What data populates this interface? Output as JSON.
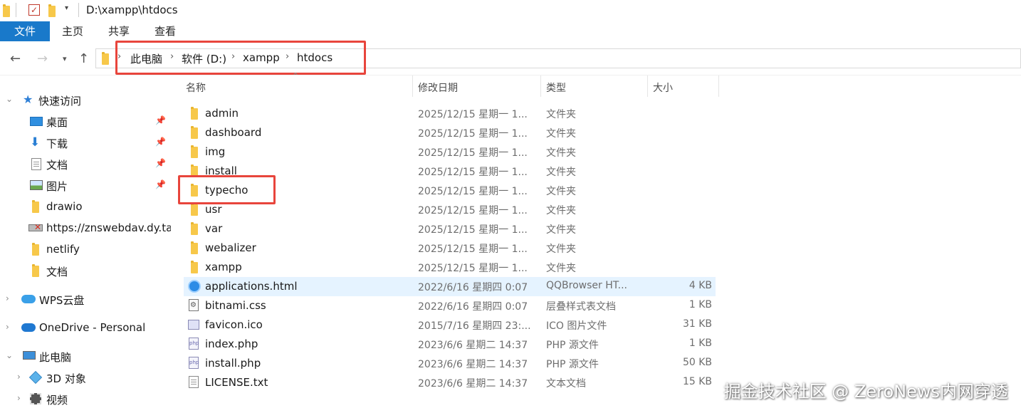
{
  "window": {
    "title": "D:\\xampp\\htdocs"
  },
  "ribbon": {
    "tabs": [
      "文件",
      "主页",
      "共享",
      "查看"
    ]
  },
  "address": {
    "crumbs": [
      "此电脑",
      "软件 (D:)",
      "xampp",
      "htdocs"
    ]
  },
  "sidebar": {
    "items": [
      {
        "label": "快速访问",
        "icon": "star-icon",
        "pinned": false
      },
      {
        "label": "桌面",
        "icon": "desktop-icon",
        "pinned": true
      },
      {
        "label": "下载",
        "icon": "download-icon",
        "pinned": true
      },
      {
        "label": "文档",
        "icon": "document-icon",
        "pinned": true
      },
      {
        "label": "图片",
        "icon": "pictures-icon",
        "pinned": true
      },
      {
        "label": "drawio",
        "icon": "folder-icon",
        "pinned": false
      },
      {
        "label": "https://znswebdav.dy.ta",
        "icon": "network-drive-icon",
        "pinned": false
      },
      {
        "label": "netlify",
        "icon": "folder-icon",
        "pinned": false
      },
      {
        "label": "文档",
        "icon": "folder-icon",
        "pinned": false
      },
      {
        "label": "WPS云盘",
        "icon": "wps-cloud-icon",
        "pinned": false
      },
      {
        "label": "OneDrive - Personal",
        "icon": "onedrive-icon",
        "pinned": false
      },
      {
        "label": "此电脑",
        "icon": "computer-icon",
        "pinned": false
      },
      {
        "label": "3D 对象",
        "icon": "3d-objects-icon",
        "pinned": false
      },
      {
        "label": "视频",
        "icon": "video-icon",
        "pinned": false
      }
    ]
  },
  "columns": {
    "name": "名称",
    "date": "修改日期",
    "type": "类型",
    "size": "大小"
  },
  "files": [
    {
      "name": "admin",
      "date": "2025/12/15 星期一 1...",
      "type": "文件夹",
      "size": "",
      "icon": "folder-icon"
    },
    {
      "name": "dashboard",
      "date": "2025/12/15 星期一 1...",
      "type": "文件夹",
      "size": "",
      "icon": "folder-icon"
    },
    {
      "name": "img",
      "date": "2025/12/15 星期一 1...",
      "type": "文件夹",
      "size": "",
      "icon": "folder-icon"
    },
    {
      "name": "install",
      "date": "2025/12/15 星期一 1...",
      "type": "文件夹",
      "size": "",
      "icon": "folder-icon"
    },
    {
      "name": "typecho",
      "date": "2025/12/15 星期一 1...",
      "type": "文件夹",
      "size": "",
      "icon": "folder-icon"
    },
    {
      "name": "usr",
      "date": "2025/12/15 星期一 1...",
      "type": "文件夹",
      "size": "",
      "icon": "folder-icon"
    },
    {
      "name": "var",
      "date": "2025/12/15 星期一 1...",
      "type": "文件夹",
      "size": "",
      "icon": "folder-icon"
    },
    {
      "name": "webalizer",
      "date": "2025/12/15 星期一 1...",
      "type": "文件夹",
      "size": "",
      "icon": "folder-icon"
    },
    {
      "name": "xampp",
      "date": "2025/12/15 星期一 1...",
      "type": "文件夹",
      "size": "",
      "icon": "folder-icon"
    },
    {
      "name": "applications.html",
      "date": "2022/6/16 星期四 0:07",
      "type": "QQBrowser HT...",
      "size": "4 KB",
      "icon": "qqbrowser-icon"
    },
    {
      "name": "bitnami.css",
      "date": "2022/6/16 星期四 0:07",
      "type": "层叠样式表文档",
      "size": "1 KB",
      "icon": "css-file-icon"
    },
    {
      "name": "favicon.ico",
      "date": "2015/7/16 星期四 23:...",
      "type": "ICO 图片文件",
      "size": "31 KB",
      "icon": "ico-file-icon"
    },
    {
      "name": "index.php",
      "date": "2023/6/6 星期二 14:37",
      "type": "PHP 源文件",
      "size": "1 KB",
      "icon": "php-file-icon"
    },
    {
      "name": "install.php",
      "date": "2023/6/6 星期二 14:37",
      "type": "PHP 源文件",
      "size": "50 KB",
      "icon": "php-file-icon"
    },
    {
      "name": "LICENSE.txt",
      "date": "2023/6/6 星期二 14:37",
      "type": "文本文档",
      "size": "15 KB",
      "icon": "text-file-icon"
    }
  ],
  "selected_file": "applications.html",
  "highlight_color": "#e8453c",
  "watermark": "掘金技术社区 @ ZeroNews内网穿透"
}
